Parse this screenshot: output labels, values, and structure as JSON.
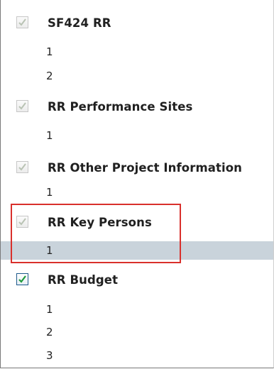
{
  "forms": [
    {
      "title": "SF424 RR",
      "checked": true,
      "enabled": false,
      "pages": [
        "1",
        "2"
      ]
    },
    {
      "title": "RR Performance Sites",
      "checked": true,
      "enabled": false,
      "pages": [
        "1"
      ]
    },
    {
      "title": "RR Other Project Information",
      "checked": true,
      "enabled": false,
      "pages": [
        "1"
      ]
    },
    {
      "title": "RR Key Persons",
      "checked": true,
      "enabled": false,
      "pages": [
        "1"
      ],
      "selected_page": "1",
      "highlighted": true
    },
    {
      "title": "RR Budget",
      "checked": true,
      "enabled": true,
      "pages": [
        "1",
        "2",
        "3"
      ]
    }
  ],
  "colors": {
    "disabled_check": "#b9c3b4",
    "enabled_check": "#1e9a3c",
    "selected_row": "#c9d3db",
    "highlight_border": "#d9302c"
  }
}
